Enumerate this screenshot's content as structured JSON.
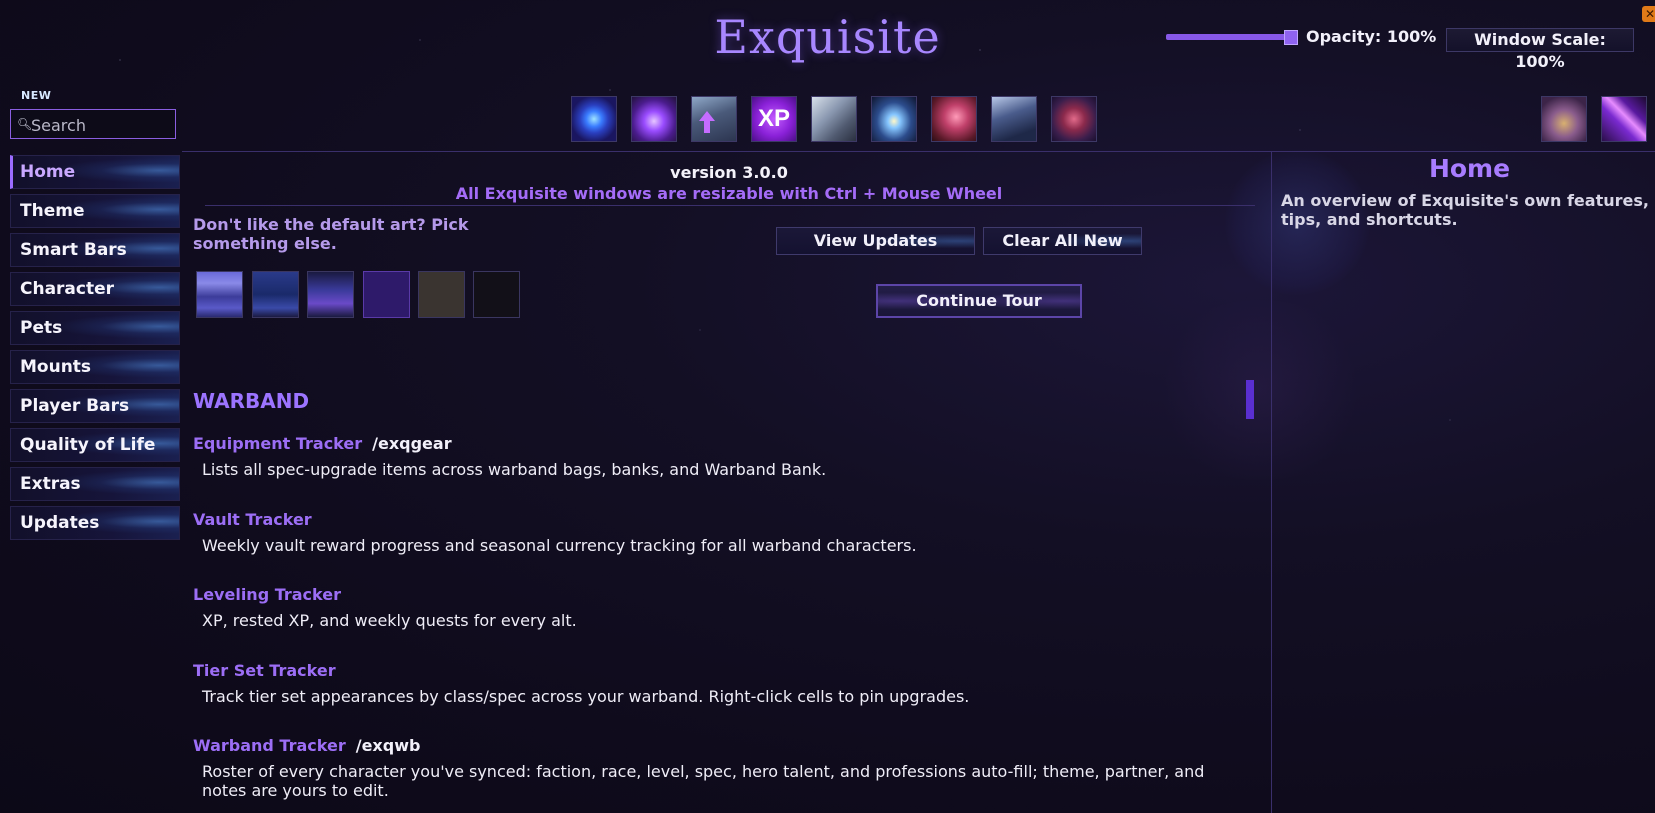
{
  "app": {
    "title": "Exquisite"
  },
  "window": {
    "opacity_label": "Opacity: 100%",
    "opacity_value": 1.0,
    "scale_label": "Window Scale: 100%",
    "close_glyph": "✕"
  },
  "sidebar": {
    "new_badge": "NEW",
    "search_placeholder": "Search",
    "items": [
      {
        "label": "Home",
        "active": true
      },
      {
        "label": "Theme"
      },
      {
        "label": "Smart Bars"
      },
      {
        "label": "Character"
      },
      {
        "label": "Pets"
      },
      {
        "label": "Mounts"
      },
      {
        "label": "Player Bars"
      },
      {
        "label": "Quality of Life"
      },
      {
        "label": "Extras"
      },
      {
        "label": "Updates"
      }
    ]
  },
  "toolbar": {
    "icons": [
      "portal-icon",
      "party-icon",
      "gear-upgrade-icon",
      "xp-icon",
      "armor-icon",
      "vault-icon",
      "dragon-mount-icon",
      "warband-icon",
      "tier-set-icon"
    ],
    "xp_text": "XP",
    "right_icons": [
      "keyring-icon",
      "crystal-icon"
    ]
  },
  "main": {
    "version": "version 3.0.0",
    "resize_note": "All Exquisite windows are resizable with Ctrl + Mouse Wheel",
    "art_prompt": "Don't like the default art? Pick something else.",
    "art_thumbs": [
      "art-thumb-1",
      "art-thumb-2",
      "art-thumb-3",
      "art-thumb-4",
      "art-thumb-5",
      "art-thumb-6"
    ],
    "view_updates_label": "View Updates",
    "clear_all_new_label": "Clear All New",
    "continue_tour_label": "Continue Tour",
    "section_title": "WARBAND",
    "features": [
      {
        "name": "Equipment Tracker",
        "cmd": "/exqgear",
        "desc": "Lists all spec-upgrade items across warband bags, banks, and Warband Bank."
      },
      {
        "name": "Vault Tracker",
        "cmd": "",
        "desc": "Weekly vault reward progress and seasonal currency tracking for all warband characters."
      },
      {
        "name": "Leveling Tracker",
        "cmd": "",
        "desc": "XP, rested XP, and weekly quests for every alt."
      },
      {
        "name": "Tier Set Tracker",
        "cmd": "",
        "desc": "Track tier set appearances by class/spec across your warband. Right-click cells to pin upgrades."
      },
      {
        "name": "Warband Tracker",
        "cmd": "/exqwb",
        "desc": "Roster of every character you've synced: faction, race, level, spec, hero talent, and professions auto-fill; theme, partner, and notes are yours to edit."
      }
    ]
  },
  "right_panel": {
    "title": "Home",
    "desc_line1": "An overview of Exquisite's own features, quick",
    "desc_line2": "tips, and shortcuts."
  }
}
